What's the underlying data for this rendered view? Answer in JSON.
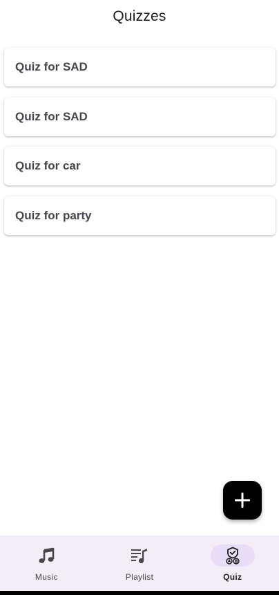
{
  "header": {
    "title": "Quizzes"
  },
  "quizzes": [
    {
      "label": "Quiz for SAD"
    },
    {
      "label": "Quiz for SAD"
    },
    {
      "label": "Quiz for car"
    },
    {
      "label": "Quiz for party"
    }
  ],
  "fab": {
    "icon": "plus-icon"
  },
  "bottom_nav": {
    "items": [
      {
        "label": "Music",
        "icon": "music-note-icon",
        "active": false
      },
      {
        "label": "Playlist",
        "icon": "playlist-icon",
        "active": false
      },
      {
        "label": "Quiz",
        "icon": "quiz-icon",
        "active": true
      }
    ]
  },
  "colors": {
    "nav_background": "#f3edf7",
    "active_indicator": "#e8def8",
    "fab_background": "#000000",
    "card_text": "#49454f"
  }
}
